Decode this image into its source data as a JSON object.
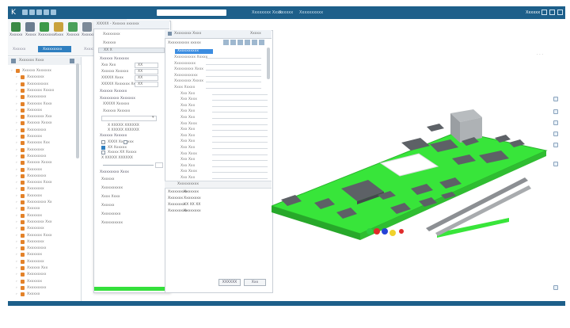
{
  "titlebar": {
    "logo": "K",
    "tabs": [
      "Xxxxxxxx Xxxx",
      "Xxxxxx",
      "Xxxxxxxxxx"
    ],
    "user": "Xxxxxx",
    "search_placeholder": ""
  },
  "ribbon": {
    "buttons": [
      "Xxxxxx",
      "Xxxxx",
      "Xxxxxxxx",
      "Xxxx",
      "Xxxxxx",
      "Xxxxxx",
      "Xxxxxxx",
      "Xxxxxxx",
      "Xxxxxxx"
    ],
    "groups": [
      "Xxxxxx",
      "Xxxxxxxxx",
      "Xxxxxx"
    ]
  },
  "tree": {
    "header": "Xxxxxxx Xxxx",
    "items": [
      "Xxxxxx Xxxxxxx",
      "Xxxxxxxx",
      "Xxxxxxxxxx",
      "Xxxxxxx Xxxxx",
      "Xxxxxxxxx",
      "Xxxxxxx Xxxx",
      "Xxxxxxx",
      "Xxxxxxxx Xxx",
      "Xxxxxx Xxxxx",
      "Xxxxxxxxx",
      "Xxxxxxx",
      "Xxxxxxx Xxx",
      "Xxxxxxxx",
      "Xxxxxxxxx",
      "Xxxxxx Xxxxx",
      "Xxxxxxx",
      "Xxxxxxxxx",
      "Xxxxxxx Xxxx",
      "Xxxxxxxx",
      "Xxxxxxx",
      "Xxxxxxxxx Xx",
      "Xxxxxx",
      "Xxxxxxx",
      "Xxxxxxxx Xxx",
      "Xxxxxxxx",
      "Xxxxxxx Xxxx",
      "Xxxxxxxx",
      "Xxxxxxxxx",
      "Xxxxxxx",
      "Xxxxxxxx",
      "Xxxxxx Xxx",
      "Xxxxxxxxx",
      "Xxxxxxx",
      "Xxxxxxxxx",
      "Xxxxxx"
    ]
  },
  "properties": {
    "title": "XXXXX - Xxxxxx xxxxxx",
    "subtitle": "Xxxxxxxx",
    "tab_label": "Xxxx",
    "name_label": "Xxxxxx",
    "id_value": "XX X",
    "section1": "Xxxxxx Xxxxxxx",
    "rows": [
      {
        "label": "Xxx Xxx",
        "value": "XX"
      },
      {
        "label": "Xxxxxx Xxxxxx",
        "value": "XX"
      },
      {
        "label": "XXXXX Xxxx",
        "value": "XX"
      },
      {
        "label": "XXXXX Xxxxxxx Xxxx",
        "value": "XX"
      }
    ],
    "section2": "Xxxxxx Xxxxxx",
    "section3": "Xxxxxxxxx Xxxxxxx",
    "sub_a": "XXXXX Xxxxxx",
    "sub_b": "Xxxxxx Xxxxxx",
    "caption": "X XXXXX XXXXXX",
    "section4": "Xxxxxx Xxxxxx",
    "check1": "XXXX Xxxxxxx",
    "check2": "XX Xxxxxx",
    "check3": "Xxxxx XX Xxxxx",
    "bottom_section": "Xxxxxxxxx Xxxx",
    "bottom_rows": [
      "Xxxxxx",
      "Xxxxxxxxxx",
      "Xxxx Xxxx",
      "Xxxxxx",
      "Xxxxxxxxx",
      "Xxxxxxxxxx"
    ]
  },
  "layer_manager": {
    "title": "Xxxxxxxx Xxxx",
    "close": "Xxxxx",
    "search": "Xxxxxxxxxx xxxxx",
    "selected": "Xxxxxxxxxx",
    "items": [
      "Xxxxxxxxxx Xxxxx",
      "Xxxxxxxxxx",
      "Xxxxxxxxx Xxxx",
      "Xxxxxxxxxxx",
      "Xxxxxxxx Xxxxx",
      "Xxxx Xxxxx",
      "Xxx Xxx",
      "Xxx Xxxx",
      "Xxx Xxx",
      "Xxx Xxx",
      "Xxx Xxx",
      "Xxx Xxxx",
      "Xxx Xxx",
      "Xxx Xxx",
      "Xxx Xxx",
      "Xxx Xxx",
      "Xxx Xxxx",
      "Xxx Xxx",
      "Xxx Xxx",
      "Xxx Xxxx",
      "Xxx Xxx"
    ],
    "detail_title": "Xxxxxxxxxx",
    "details": [
      {
        "key": "Xxxxxxxxx",
        "value": "Xxxxxxx"
      },
      {
        "key": "Xxxxxxx",
        "value": "Xxxxxxxx"
      },
      {
        "key": "Xxxxxxxx",
        "value": "XX XX XX"
      },
      {
        "key": "Xxxxxxxxx",
        "value": "Xxxxxxxx"
      }
    ],
    "ok": "XXXXXX",
    "cancel": "Xxx"
  },
  "colors": {
    "accent": "#1d5f8a",
    "highlight": "#3c8de0",
    "tree_icon": "#e3822a",
    "pcb_green": "#38e53a",
    "chip": "#5d6166"
  },
  "icons": [
    "close-icon",
    "expand-icon",
    "layer-icon",
    "view-icon",
    "settings-icon"
  ]
}
